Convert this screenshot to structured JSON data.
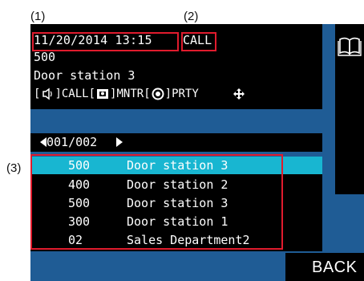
{
  "annotations": {
    "label_1": "(1)",
    "label_2": "(2)",
    "label_3": "(3)"
  },
  "status": {
    "datetime": "11/20/2014 13:15",
    "call_state": "CALL",
    "number": "500",
    "station": "Door station 3"
  },
  "operations": {
    "call_label": "CALL",
    "monitor_label": "MNTR",
    "party_label": "PRTY",
    "icons": [
      "speaker-icon",
      "monitor-icon",
      "party-icon",
      "move-arrows-icon"
    ]
  },
  "pager": {
    "label": "001/002"
  },
  "list": {
    "rows": [
      {
        "number": "500",
        "name": "Door station 3",
        "selected": true
      },
      {
        "number": "400",
        "name": "Door station 2",
        "selected": false
      },
      {
        "number": "500",
        "name": "Door station 3",
        "selected": false
      },
      {
        "number": "300",
        "name": "Door station 1",
        "selected": false
      },
      {
        "number": "02",
        "name": "Sales Department2",
        "selected": false
      }
    ]
  },
  "buttons": {
    "back_label": "BACK"
  },
  "colors": {
    "background": "#1f5c95",
    "panel": "#000000",
    "selection": "#18b6d1",
    "annotation_box": "#e01b2d"
  }
}
